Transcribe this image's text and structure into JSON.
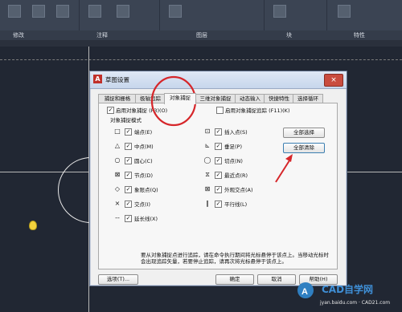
{
  "ribbon": {
    "panels": [
      "修改",
      "注释",
      "图层",
      "块",
      "特性"
    ]
  },
  "dialog": {
    "title": "草图设置",
    "close": "×",
    "tabs": [
      "捕捉和栅格",
      "极轴追踪",
      "对象捕捉",
      "三维对象捕捉",
      "动态输入",
      "快捷特性",
      "选择循环"
    ],
    "active_tab": "对象捕捉",
    "enable_snap": {
      "label": "启用对象捕捉 (F3)(O)",
      "checked": true
    },
    "enable_track": {
      "label": "启用对象捕捉追踪 (F11)(K)",
      "checked": false
    },
    "group_label": "对象捕捉模式",
    "modes_left": [
      {
        "symbol": "□",
        "label": "端点(E)",
        "checked": true
      },
      {
        "symbol": "△",
        "label": "中点(M)",
        "checked": true
      },
      {
        "symbol": "○",
        "label": "圆心(C)",
        "checked": true
      },
      {
        "symbol": "⊠",
        "label": "节点(D)",
        "checked": true
      },
      {
        "symbol": "◇",
        "label": "象限点(Q)",
        "checked": true
      },
      {
        "symbol": "×",
        "label": "交点(I)",
        "checked": true
      },
      {
        "symbol": "--",
        "label": "延长线(X)",
        "checked": true
      }
    ],
    "modes_right": [
      {
        "symbol": "⊡",
        "label": "插入点(S)",
        "checked": true
      },
      {
        "symbol": "⊾",
        "label": "垂足(P)",
        "checked": true
      },
      {
        "symbol": "◯",
        "label": "切点(N)",
        "checked": true
      },
      {
        "symbol": "⧖",
        "label": "最近点(R)",
        "checked": true
      },
      {
        "symbol": "⊠",
        "label": "外观交点(A)",
        "checked": true
      },
      {
        "symbol": "∥",
        "label": "平行线(L)",
        "checked": true
      }
    ],
    "select_all": "全部选择",
    "clear_all": "全部清除",
    "hint": "要从对象捕捉点进行追踪，请在命令执行期间将光标悬停于该点上。当移动光标时会出现追踪矢量，若要停止追踪，请再次将光标悬停于该点上。",
    "options_btn": "选项(T)...",
    "ok_btn": "确定",
    "cancel_btn": "取消",
    "help_btn": "帮助(H)"
  },
  "watermark": {
    "logo": "CAD自学网",
    "url": "jyan.baidu.com · CAD21.com"
  },
  "colors": {
    "annotation_red": "#d6262a",
    "ribbon_bg": "#3b4453",
    "canvas_bg": "#212733"
  }
}
